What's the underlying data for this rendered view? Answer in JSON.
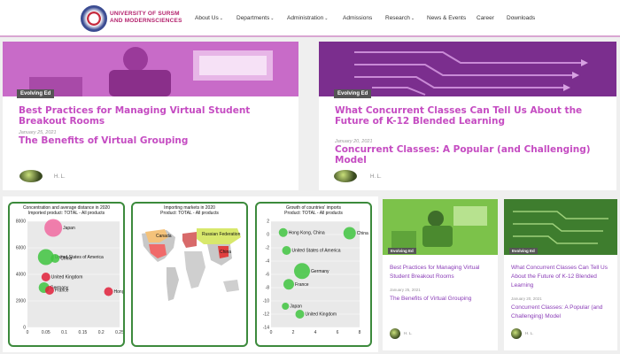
{
  "header": {
    "brand_line1": "UNIVERSITY OF SURSM",
    "brand_line2": "AND MODERNSCIENCES",
    "nav": [
      {
        "label": "About Us",
        "dropdown": true
      },
      {
        "label": "Departments",
        "dropdown": true
      },
      {
        "label": "Administration",
        "dropdown": true
      },
      {
        "label": "Admissions",
        "dropdown": false
      },
      {
        "label": "Research",
        "dropdown": true
      },
      {
        "label": "News & Events",
        "dropdown": false
      },
      {
        "label": "Career",
        "dropdown": false
      },
      {
        "label": "Downloads",
        "dropdown": false
      }
    ],
    "chevron": "⌄"
  },
  "cards": [
    {
      "tag": "Evolving Ed",
      "title": "Best Practices for Managing Virtual Student Breakout Rooms",
      "date": "January 25, 2021",
      "subtitle": "The Benefits of Virtual Grouping",
      "author": "H. L.",
      "image_color": "#c45ec4"
    },
    {
      "tag": "Evolving Ed",
      "title": "What Concurrent Classes Can Tell Us About the Future of K-12 Blended Learning",
      "date": "January 20, 2021",
      "subtitle": "Concurrent Classes: A Popular (and Challenging) Model",
      "author": "H. L.",
      "image_color": "#7b2e8e"
    }
  ],
  "small_cards": [
    {
      "tag": "Evolving Ed",
      "title": "Best Practices for Managing Virtual Student Breakout Rooms",
      "date": "January 25, 2021",
      "subtitle": "The Benefits of Virtual Grouping",
      "author": "H. L.",
      "image_color": "#7cc24a"
    },
    {
      "tag": "Evolving Ed",
      "title": "What Concurrent Classes Can Tell Us About the Future of K-12 Blended Learning",
      "date": "January 20, 2021",
      "subtitle": "Concurrent Classes: A Popular (and Challenging) Model",
      "author": "H. L.",
      "image_color": "#3e7d2e"
    }
  ],
  "colors": {
    "accent": "#c54cc2",
    "chart_border": "#3c8a3c",
    "bubble_green": "#3fc43f",
    "bubble_red": "#e0203a",
    "bubble_pink": "#f06aa0"
  },
  "chart_data": [
    {
      "type": "scatter",
      "title": "Concentration and average distance in 2020",
      "subtitle": "Imported product: TOTAL - All products",
      "xlim": [
        0,
        0.25
      ],
      "ylim": [
        0,
        8000
      ],
      "x_ticks": [
        "0",
        "0.05",
        "0.1",
        "0.15",
        "0.2",
        "0.25"
      ],
      "y_ticks": [
        "0",
        "2000",
        "4000",
        "6000",
        "8000"
      ],
      "points": [
        {
          "label": "Japan",
          "x": 0.07,
          "y": 7500,
          "r": 10,
          "color": "#f06aa0"
        },
        {
          "label": "United States of America",
          "x": 0.05,
          "y": 5300,
          "r": 9,
          "color": "#3fc43f"
        },
        {
          "label": "China",
          "x": 0.075,
          "y": 5200,
          "r": 5,
          "color": "#3fc43f"
        },
        {
          "label": "United Kingdom",
          "x": 0.05,
          "y": 3800,
          "r": 5,
          "color": "#e0203a"
        },
        {
          "label": "Germany",
          "x": 0.045,
          "y": 3000,
          "r": 6,
          "color": "#3fc43f"
        },
        {
          "label": "France",
          "x": 0.06,
          "y": 2800,
          "r": 5,
          "color": "#e0203a"
        },
        {
          "label": "Hong Kong, China",
          "x": 0.22,
          "y": 2700,
          "r": 5,
          "color": "#e0203a"
        }
      ]
    },
    {
      "type": "map",
      "title": "Importing markets in 2020",
      "subtitle": "Product: TOTAL - All products",
      "labels": [
        "Canada",
        "Russian Federation",
        "China"
      ]
    },
    {
      "type": "scatter",
      "title": "Growth of countries' imports",
      "subtitle": "Product: TOTAL - All products",
      "xlim": [
        0,
        8
      ],
      "ylim": [
        -14,
        2
      ],
      "x_ticks": [
        "0",
        "2",
        "4",
        "6",
        "8"
      ],
      "y_ticks": [
        "2",
        "0",
        "-2",
        "-4",
        "-6",
        "-8",
        "-10",
        "-12",
        "-14"
      ],
      "points": [
        {
          "label": "Hong Kong, China",
          "x": 1.1,
          "y": 0.3,
          "r": 5,
          "color": "#3fc43f"
        },
        {
          "label": "China",
          "x": 7.1,
          "y": 0.2,
          "r": 7,
          "color": "#3fc43f"
        },
        {
          "label": "United States of America",
          "x": 1.4,
          "y": -2.4,
          "r": 5,
          "color": "#3fc43f"
        },
        {
          "label": "Germany",
          "x": 2.8,
          "y": -5.5,
          "r": 9,
          "color": "#3fc43f"
        },
        {
          "label": "France",
          "x": 1.6,
          "y": -7.5,
          "r": 6,
          "color": "#3fc43f"
        },
        {
          "label": "Japan",
          "x": 1.3,
          "y": -10.8,
          "r": 4,
          "color": "#3fc43f"
        },
        {
          "label": "United Kingdom",
          "x": 2.6,
          "y": -12.0,
          "r": 5,
          "color": "#3fc43f"
        }
      ]
    }
  ]
}
